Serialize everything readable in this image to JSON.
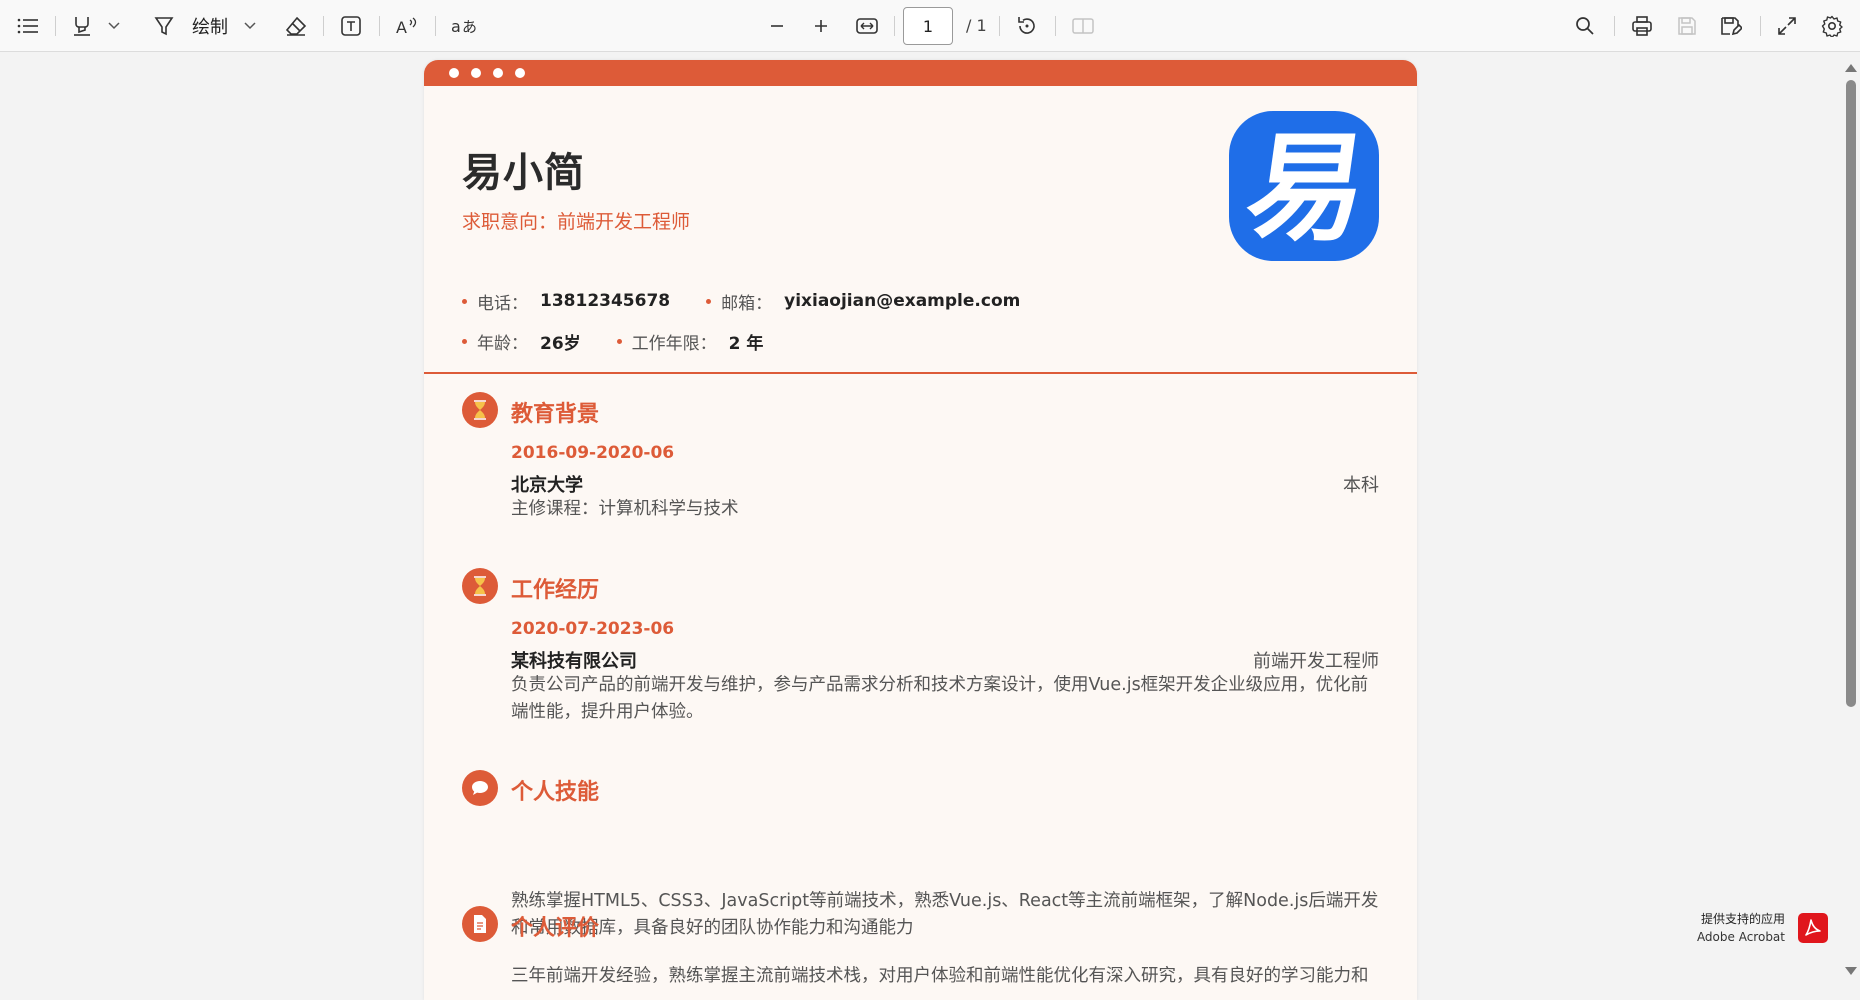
{
  "toolbar": {
    "draw_label": "绘制",
    "page_current": "1",
    "page_total": "/ 1"
  },
  "resume": {
    "name": "易小简",
    "intent": "求职意向：前端开发工程师",
    "logo_glyph": "易",
    "info": {
      "phone_label": "电话：",
      "phone": "13812345678",
      "email_label": "邮箱：",
      "email": "yixiaojian@example.com",
      "age_label": "年龄：",
      "age": "26岁",
      "years_label": "工作年限：",
      "years": "2 年"
    },
    "education": {
      "title": "教育背景",
      "date": "2016-09-2020-06",
      "school": "北京大学",
      "degree": "本科",
      "course": "主修课程：计算机科学与技术"
    },
    "work": {
      "title": "工作经历",
      "date": "2020-07-2023-06",
      "company": "某科技有限公司",
      "position": "前端开发工程师",
      "description": "负责公司产品的前端开发与维护，参与产品需求分析和技术方案设计，使用Vue.js框架开发企业级应用，优化前端性能，提升用户体验。"
    },
    "skills": {
      "title": "个人技能",
      "text": "熟练掌握HTML5、CSS3、JavaScript等前端技术，熟悉Vue.js、React等主流前端框架，了解Node.js后端开发和常用数据库，具备良好的团队协作能力和沟通能力"
    },
    "evaluation": {
      "title": "个人评价",
      "text": "三年前端开发经验，熟练掌握主流前端技术栈，对用户体验和前端性能优化有深入研究，具有良好的学习能力和"
    }
  },
  "acrobat": {
    "line1": "提供支持的应用",
    "line2": "Adobe Acrobat"
  },
  "colors": {
    "accent": "#dd5b38",
    "logo_blue": "#1f6ee8",
    "page_bg": "#fdf8f4"
  }
}
